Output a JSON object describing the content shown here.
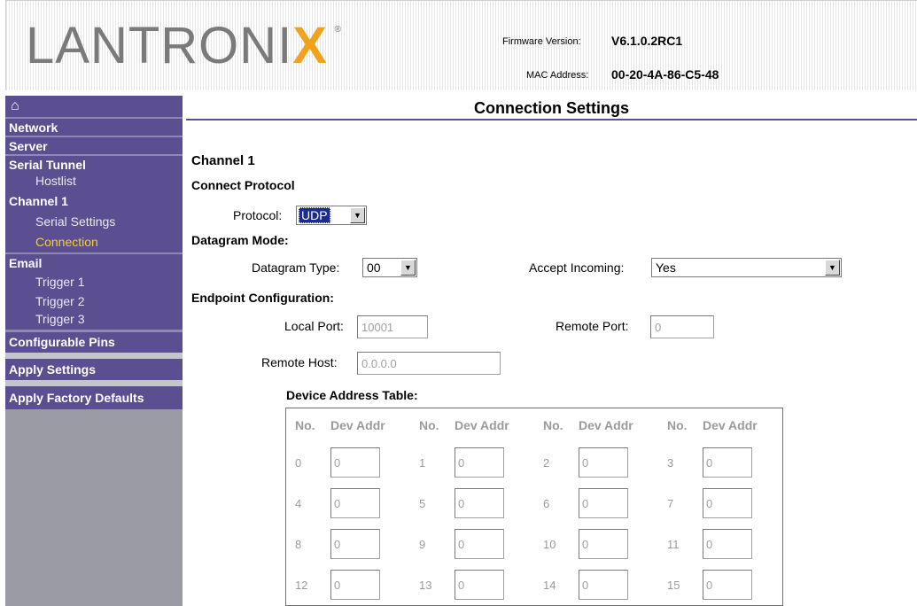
{
  "header": {
    "logo_main": "LANTRONI",
    "logo_x": "X",
    "logo_reg": "®",
    "firmware_label": "Firmware Version:",
    "firmware_value": "V6.1.0.2RC1",
    "mac_label": "MAC Address:",
    "mac_value": "00-20-4A-86-C5-48"
  },
  "sidebar": {
    "home_icon": "⌂",
    "network": "Network",
    "server": "Server",
    "serial_tunnel": "Serial Tunnel",
    "hostlist": "Hostlist",
    "channel1": "Channel 1",
    "serial_settings": "Serial Settings",
    "connection": "Connection",
    "email": "Email",
    "trigger1": "Trigger 1",
    "trigger2": "Trigger 2",
    "trigger3": "Trigger 3",
    "configurable_pins": "Configurable Pins",
    "apply_settings": "Apply Settings",
    "apply_factory_defaults": "Apply Factory Defaults"
  },
  "main": {
    "title": "Connection Settings",
    "channel_heading": "Channel 1",
    "connect_protocol_heading": "Connect Protocol",
    "protocol_label": "Protocol:",
    "protocol_value": "UDP",
    "datagram_heading": "Datagram Mode:",
    "datagram_type_label": "Datagram Type:",
    "datagram_type_value": "00",
    "accept_incoming_label": "Accept Incoming:",
    "accept_incoming_value": "Yes",
    "endpoint_heading": "Endpoint Configuration:",
    "local_port_label": "Local Port:",
    "local_port_value": "10001",
    "remote_port_label": "Remote Port:",
    "remote_port_value": "0",
    "remote_host_label": "Remote Host:",
    "remote_host_value": "0.0.0.0",
    "device_table_heading": "Device Address Table:"
  },
  "device_table": {
    "headers": [
      "No.",
      "Dev Addr",
      "No.",
      "Dev Addr",
      "No.",
      "Dev Addr",
      "No.",
      "Dev Addr"
    ],
    "rows": [
      [
        {
          "no": "0",
          "addr": "0"
        },
        {
          "no": "1",
          "addr": "0"
        },
        {
          "no": "2",
          "addr": "0"
        },
        {
          "no": "3",
          "addr": "0"
        }
      ],
      [
        {
          "no": "4",
          "addr": "0"
        },
        {
          "no": "5",
          "addr": "0"
        },
        {
          "no": "6",
          "addr": "0"
        },
        {
          "no": "7",
          "addr": "0"
        }
      ],
      [
        {
          "no": "8",
          "addr": "0"
        },
        {
          "no": "9",
          "addr": "0"
        },
        {
          "no": "10",
          "addr": "0"
        },
        {
          "no": "11",
          "addr": "0"
        }
      ],
      [
        {
          "no": "12",
          "addr": "0"
        },
        {
          "no": "13",
          "addr": "0"
        },
        {
          "no": "14",
          "addr": "0"
        },
        {
          "no": "15",
          "addr": "0"
        }
      ]
    ]
  },
  "colors": {
    "sidebar_bg": "#5b4f91",
    "active_link": "#f7d21b",
    "logo_accent": "#f0a21a"
  }
}
